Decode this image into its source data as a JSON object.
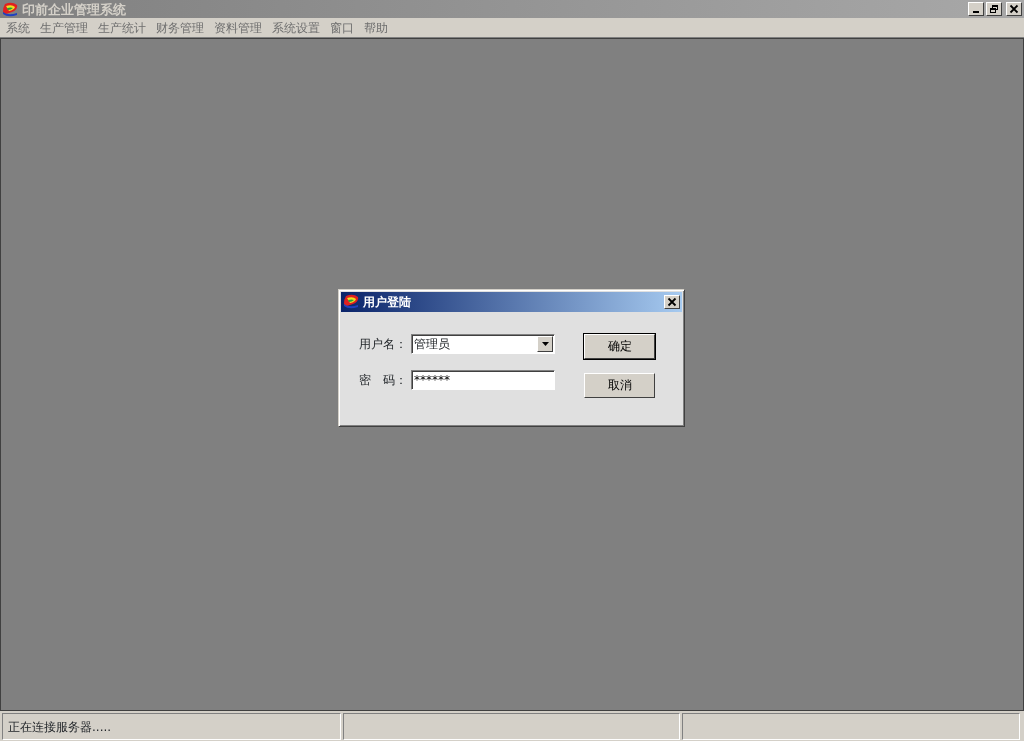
{
  "window": {
    "title": "印前企业管理系统"
  },
  "menu": [
    "系统",
    "生产管理",
    "生产统计",
    "财务管理",
    "资料管理",
    "系统设置",
    "窗口",
    "帮助"
  ],
  "dialog": {
    "title": "用户登陆",
    "fields": [
      {
        "kind": "dropdown",
        "label": "用户名：",
        "value": "管理员"
      },
      {
        "kind": "password",
        "label": "密　码：",
        "value": "******"
      }
    ],
    "buttons": [
      {
        "label": "确定",
        "default": true
      },
      {
        "label": "取消",
        "default": false
      }
    ]
  },
  "status_bar": {
    "text": "正在连接服务器....."
  }
}
